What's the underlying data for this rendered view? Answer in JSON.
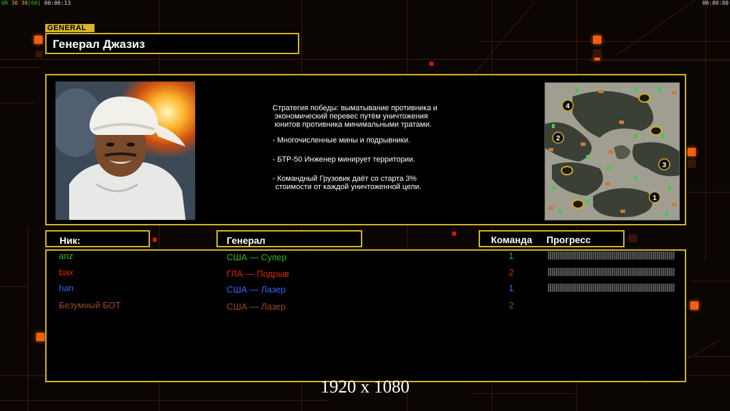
{
  "hud": {
    "left_prefix": "0R",
    "left_values": "30 30",
    "left_bracket": "[60]",
    "left_time": "00:06:13",
    "right_time": "00:00:00"
  },
  "header": {
    "tag": "GENERAL",
    "title": "Генерал Джазиз"
  },
  "general_info": {
    "strategy_lines": [
      "Стратегия победы: выматывание противника и",
      "экономический перевес путём уничтожения",
      "юнитов противника минимальными тратами."
    ],
    "bullets": [
      {
        "lines": [
          "Многочисленные мины и подрывники."
        ]
      },
      {
        "lines": [
          "БТР-50 Инженер минирует территории."
        ]
      },
      {
        "lines": [
          "Командный Грузовик даёт со старта 3%",
          "стоимости от каждой уничтоженной цели."
        ]
      }
    ]
  },
  "map": {
    "start_positions": [
      "1",
      "2",
      "3",
      "4"
    ]
  },
  "table": {
    "headers": {
      "nick": "Ник:",
      "general": "Генерал",
      "team": "Команда",
      "progress": "Прогресс"
    },
    "players": [
      {
        "nick": "anz",
        "general": "США — Супер",
        "team": "1",
        "color": "#35b820",
        "progress": 0
      },
      {
        "nick": "bax",
        "general": "ГЛА — Подрыв",
        "team": "2",
        "color": "#e02010",
        "progress": 0
      },
      {
        "nick": "han",
        "general": "США — Лазер",
        "team": "1",
        "color": "#3a66ff",
        "progress": 0
      },
      {
        "nick": "Безумный БОТ",
        "general": "США — Лазер",
        "team": "2",
        "color": "#9a4a26",
        "progress": null
      }
    ]
  },
  "resolution": "1920 x 1080",
  "colors": {
    "accent": "#d7b52a",
    "orange": "#f06010"
  }
}
